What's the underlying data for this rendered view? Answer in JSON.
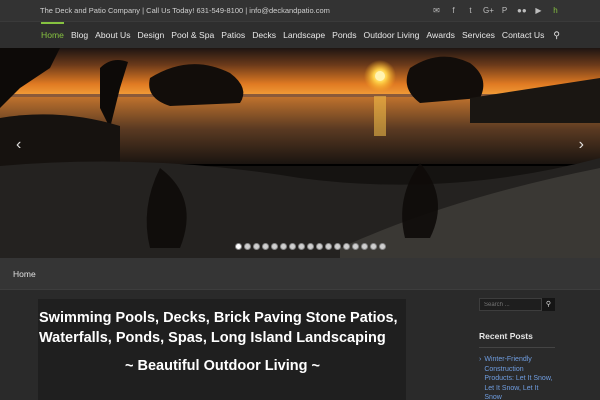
{
  "topbar": {
    "tagline": "The Deck and Patio Company | Call Us Today! 631-549-8100 | info@deckandpatio.com",
    "social_icons": [
      "email-icon",
      "facebook-icon",
      "twitter-icon",
      "google-plus-icon",
      "pinterest-icon",
      "flickr-icon",
      "youtube-icon",
      "houzz-icon"
    ]
  },
  "nav": {
    "items": [
      {
        "label": "Home",
        "active": true
      },
      {
        "label": "Blog"
      },
      {
        "label": "About Us"
      },
      {
        "label": "Design"
      },
      {
        "label": "Pool & Spa"
      },
      {
        "label": "Patios"
      },
      {
        "label": "Decks"
      },
      {
        "label": "Landscape"
      },
      {
        "label": "Ponds"
      },
      {
        "label": "Outdoor Living"
      },
      {
        "label": "Awards"
      },
      {
        "label": "Services"
      },
      {
        "label": "Contact Us"
      }
    ],
    "search_icon": "search-icon"
  },
  "slider": {
    "prev_icon": "chevron-left-icon",
    "next_icon": "chevron-right-icon",
    "slide_count": 17,
    "active_slide": 1
  },
  "breadcrumb": {
    "current": "Home"
  },
  "main": {
    "headline": "Swimming Pools, Decks, Brick Paving Stone Patios, Waterfalls, Ponds, Spas, Long Island Landscaping",
    "subhead": "~ Beautiful Outdoor Living ~"
  },
  "sidebar": {
    "search_placeholder": "Search ...",
    "recent_title": "Recent Posts",
    "posts": [
      "Winter-Friendly Construction Products: Let It Snow, Let It Snow, Let It Snow"
    ]
  },
  "colors": {
    "accent": "#86c240",
    "link": "#6f9de0"
  }
}
